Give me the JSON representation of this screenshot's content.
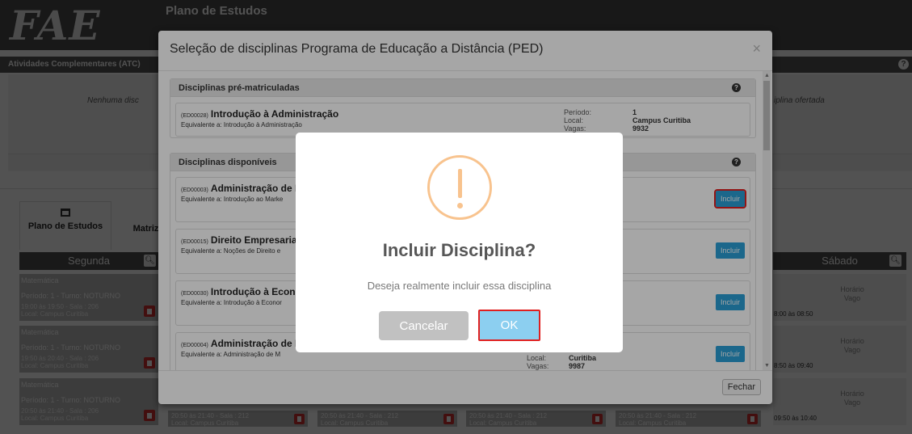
{
  "app": {
    "logo": "FAE",
    "title": "Plano de Estudos"
  },
  "atc": {
    "header": "Atividades Complementares (ATC)",
    "left_text": "Nenhuma disc",
    "right_text": "iplina ofertada"
  },
  "tabs": [
    {
      "label": "Plano de Estudos"
    },
    {
      "label": "Matriz"
    }
  ],
  "schedule": {
    "segunda": "Segunda",
    "sabado": "Sábado",
    "slots": [
      {
        "subject": "Matemática",
        "periodo": "Período: 1 - Turno: NOTURNO",
        "time": "19:00 às 19:50 - Sala : 206",
        "local": "Local: Campus Curitiba"
      },
      {
        "subject": "Matemática",
        "periodo": "Período: 1 - Turno: NOTURNO",
        "time": "19:50 às 20:40 - Sala : 206",
        "local": "Local: Campus Curitiba"
      },
      {
        "subject": "Matemática",
        "periodo": "Período: 1 - Turno: NOTURNO",
        "time": "20:50 às 21:40 - Sala : 206",
        "local": "Local: Campus Curitiba"
      }
    ],
    "sabado_slots": [
      {
        "status": "Horário Vago",
        "time": "8:00 às 08:50"
      },
      {
        "status": "Horário Vago",
        "time": "8:50 às 09:40"
      },
      {
        "status": "Horário Vago",
        "time": "09:50 às 10:40"
      }
    ],
    "bottom_cells": [
      {
        "time": "20:50 às 21:40 - Sala : 212",
        "local": "Local: Campus Curitiba"
      },
      {
        "time": "20:50 às 21:40 - Sala : 212",
        "local": "Local: Campus Curitiba"
      },
      {
        "time": "20:50 às 21:40 - Sala : 212",
        "local": "Local: Campus Curitiba"
      },
      {
        "time": "20:50 às 21:40 - Sala : 212",
        "local": "Local: Campus Curitiba"
      }
    ]
  },
  "modal": {
    "title": "Seleção de disciplinas Programa de Educação a Distância (PED)",
    "close": "×",
    "fechar": "Fechar",
    "pre": {
      "header": "Disciplinas pré-matriculadas",
      "item": {
        "code": "(ED00028)",
        "name": "Introdução à Administração",
        "equiv": "Equivalente a: Introdução à Administração",
        "labels": "Período:\nLocal:\nVagas:",
        "values": "1\nCampus Curitiba\n9932"
      }
    },
    "disp": {
      "header": "Disciplinas disponíveis",
      "items": [
        {
          "code": "(ED00003)",
          "name": "Administração de M",
          "equiv": "Equivalente a: Introdução ao Marke",
          "button": "Incluir"
        },
        {
          "code": "(ED00015)",
          "name": "Direito Empresarial",
          "equiv": "Equivalente a: Noções de Direito e",
          "button": "Incluir"
        },
        {
          "code": "(ED00030)",
          "name": "Introdução à Econc",
          "equiv": "Equivalente a: Introdução à Econor",
          "button": "Incluir"
        },
        {
          "code": "(ED00004)",
          "name": "Administração de M",
          "equiv": "Equivalente a: Administração de M",
          "button": "Incluir",
          "labels": "Local:\nVagas:",
          "values": "Curitiba\n9987"
        }
      ]
    }
  },
  "confirm": {
    "title": "Incluir Disciplina?",
    "text": "Deseja realmente incluir essa disciplina",
    "cancel": "Cancelar",
    "ok": "OK"
  },
  "colors": {
    "confirm_button": "#8ccff0",
    "cancel_button": "#c1c1c1",
    "incluir_button": "#2a9fd6",
    "warning_icon": "#f8c38e",
    "highlight": "#e02020"
  }
}
